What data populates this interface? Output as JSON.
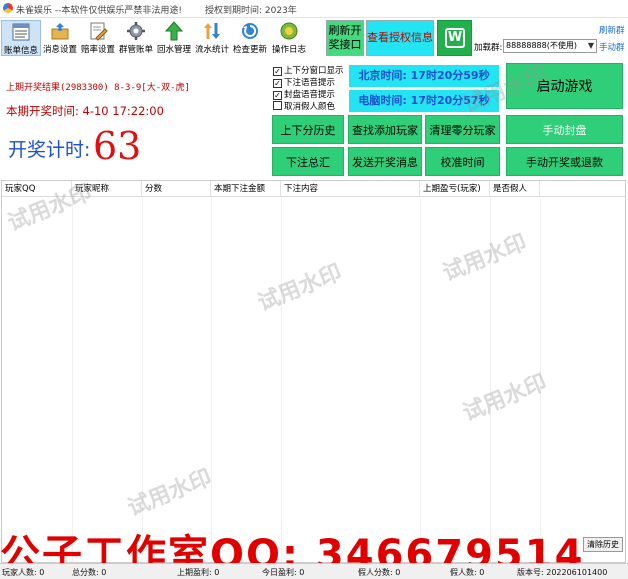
{
  "window": {
    "title": "朱雀娱乐 --本软件仅供娱乐严禁非法用途!",
    "expire_text": "授权到期时间: 2023年"
  },
  "toolbar": {
    "items": [
      {
        "label": "账单信息",
        "icon": "ledger-icon"
      },
      {
        "label": "消息设置",
        "icon": "message-folder-icon"
      },
      {
        "label": "赔率设置",
        "icon": "odds-edit-icon"
      },
      {
        "label": "群管账单",
        "icon": "gear-icon"
      },
      {
        "label": "回水管理",
        "icon": "up-arrow-icon"
      },
      {
        "label": "流水统计",
        "icon": "flow-arrows-icon"
      },
      {
        "label": "检查更新",
        "icon": "refresh-icon"
      },
      {
        "label": "操作日志",
        "icon": "log-badge-icon"
      }
    ],
    "refresh_api_label": "刷新开奖接口",
    "view_auth_label": "查看授权信息",
    "group_label": "加载群:",
    "group_selected": "88888888(不使用)",
    "refresh_group_link": "刷新群",
    "manual_group_link": "手动群"
  },
  "colors": {
    "lime": "#44d97e",
    "cyan": "#22e4f2",
    "green": "#2ecf78",
    "red": "#c00000",
    "blue": "#1d4fd1"
  },
  "info": {
    "last_result": "上期开奖结果(2983300)  8-3-9[大-双-虎]",
    "period_time": "本期开奖时间: 4-10  17:22:00",
    "countdown_label": "开奖计时:",
    "countdown_value": "63"
  },
  "checkboxes": [
    {
      "label": "上下分窗口显示",
      "checked": true
    },
    {
      "label": "下注语音提示",
      "checked": true
    },
    {
      "label": "封盘语音提示",
      "checked": true
    },
    {
      "label": "取消假人颜色",
      "checked": false
    }
  ],
  "times": {
    "beijing": "北京时间: 17时20分59秒",
    "computer": "电脑时间: 17时20分57秒"
  },
  "buttons": {
    "start_game": "启动游戏",
    "updown_history": "上下分历史",
    "find_add_player": "查找添加玩家",
    "clear_zero_players": "清理零分玩家",
    "manual_close": "手动封盘",
    "bet_summary": "下注总汇",
    "send_draw_msg": "发送开奖消息",
    "calibrate_time": "校准时间",
    "manual_draw_refund": "手动开奖或退款"
  },
  "table": {
    "columns": [
      "玩家QQ",
      "玩家昵称",
      "分数",
      "本期下注金额",
      "下注内容",
      "上期盈亏(玩家)",
      "是否假人"
    ]
  },
  "watermark_text": "试用水印",
  "footer_banner": "公子工作室QQ: 346679514",
  "clear_history_btn": "清除历史",
  "status": {
    "players": "玩家人数: 0",
    "total_score": "总分数: 0",
    "last_profit": "上期盈利: 0",
    "today_profit": "今日盈利: 0",
    "fake_score": "假人分数: 0",
    "fake_count": "假人数: 0",
    "version": "版本号: 202206101400"
  }
}
